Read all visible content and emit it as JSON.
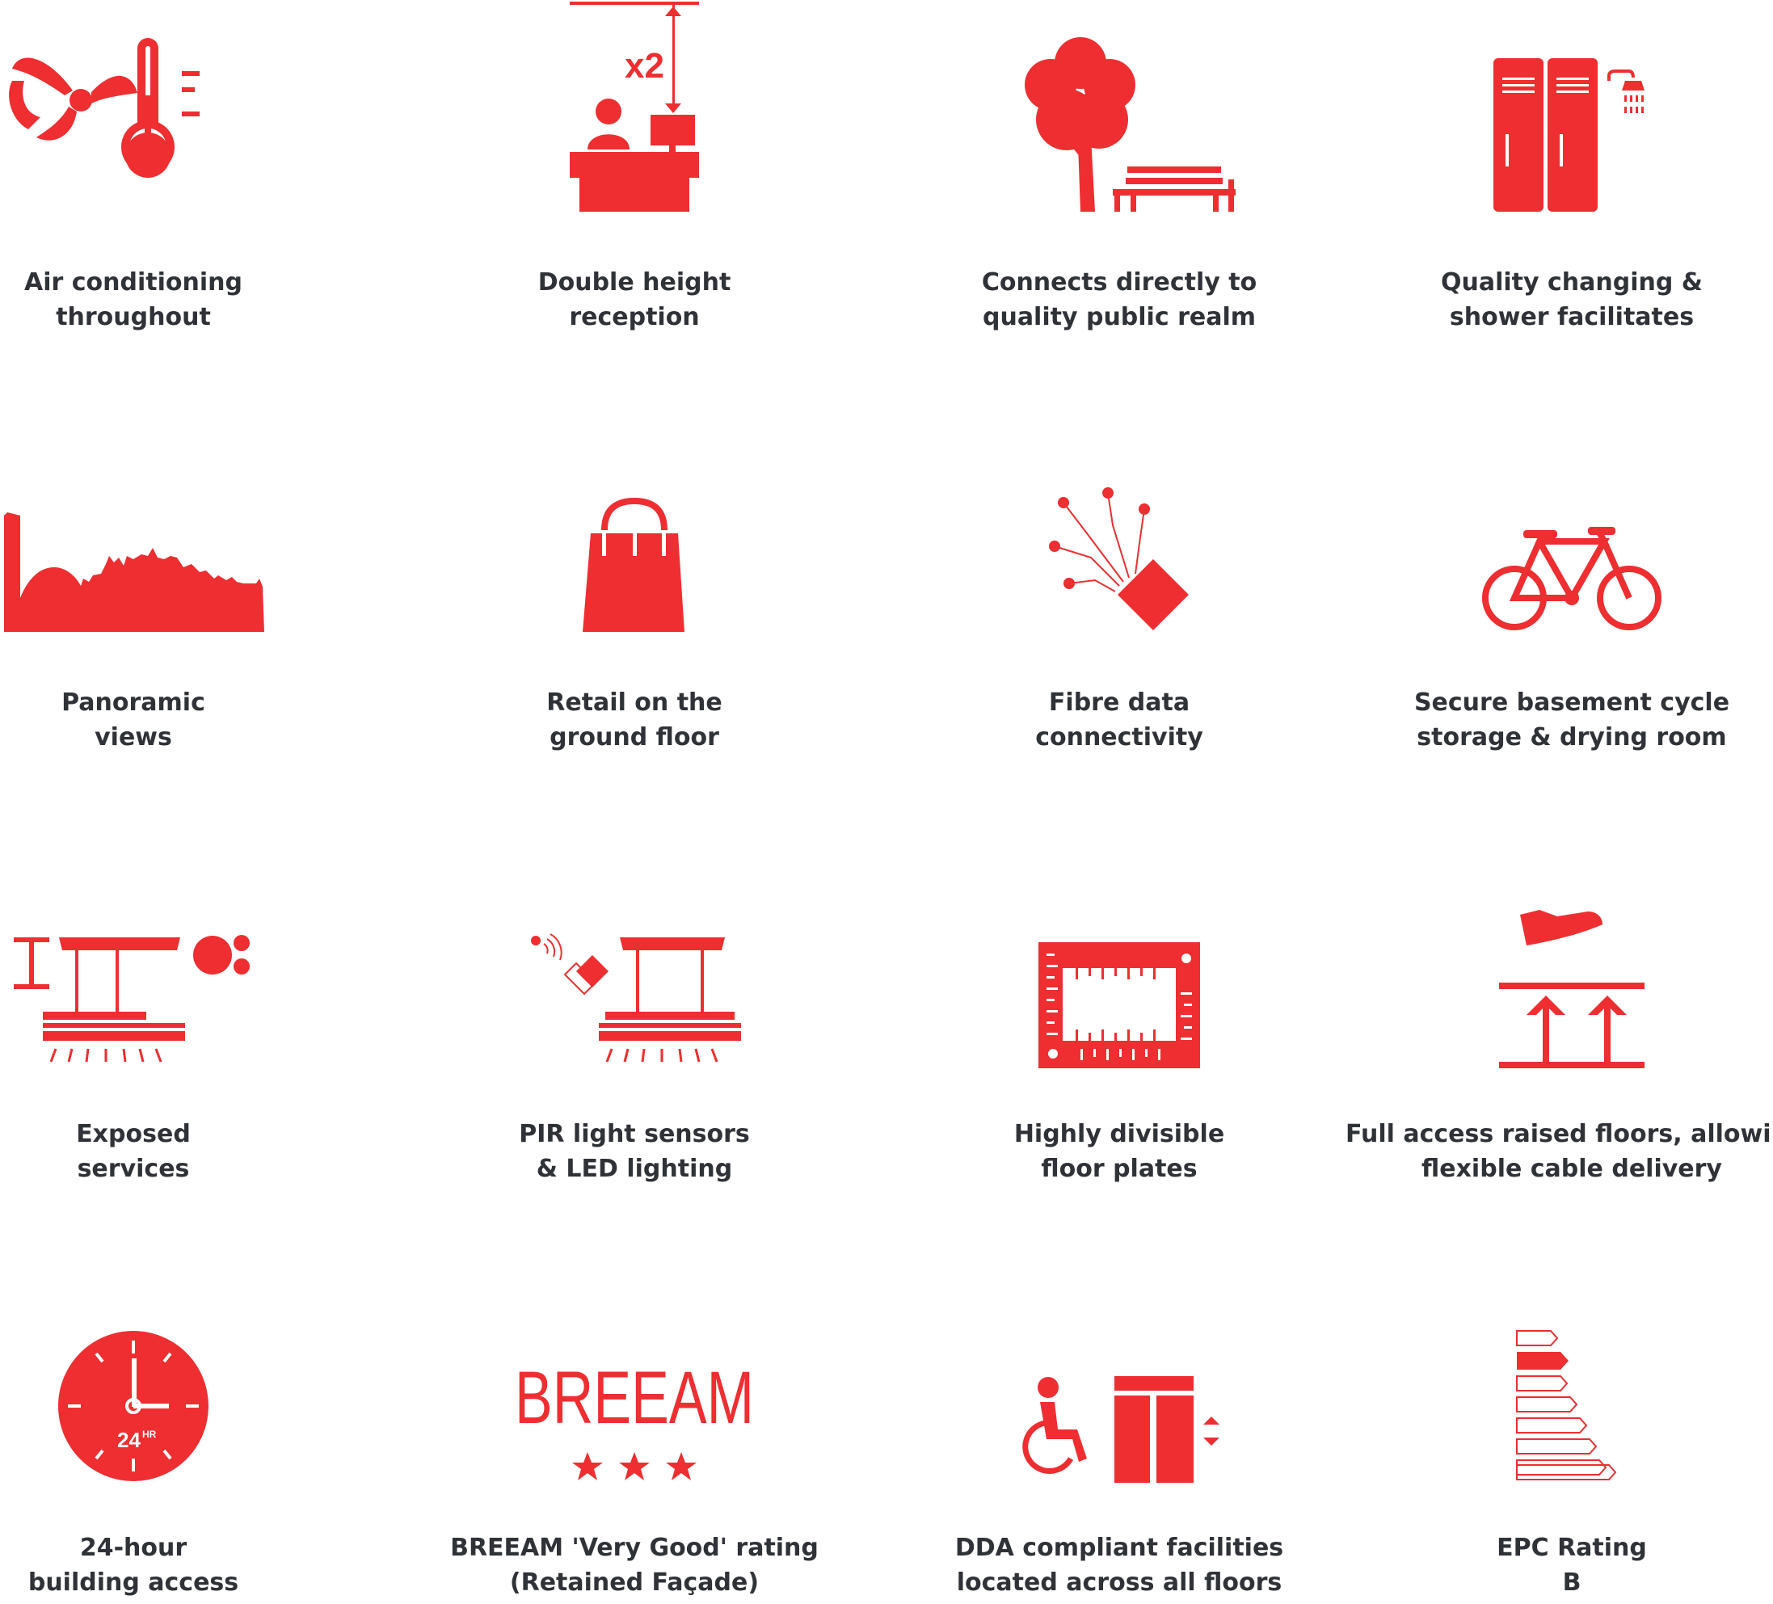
{
  "accent_color": "#ee2e31",
  "text_color": "#2f3237",
  "features": [
    {
      "id": "air-conditioning",
      "icon": "fan-thermometer-icon",
      "line1": "Air conditioning",
      "line2": "throughout"
    },
    {
      "id": "double-height-reception",
      "icon": "reception-desk-icon",
      "icon_text": "x2",
      "line1": "Double height",
      "line2": "reception"
    },
    {
      "id": "public-realm",
      "icon": "tree-bench-icon",
      "line1": "Connects directly to",
      "line2": "quality public realm"
    },
    {
      "id": "changing-shower",
      "icon": "lockers-shower-icon",
      "line1": "Quality changing &",
      "line2": "shower facilitates"
    },
    {
      "id": "panoramic-views",
      "icon": "skyline-icon",
      "line1": "Panoramic",
      "line2": "views"
    },
    {
      "id": "retail",
      "icon": "shopping-bag-icon",
      "line1": "Retail on the",
      "line2": "ground floor"
    },
    {
      "id": "fibre-data",
      "icon": "fibre-connector-icon",
      "line1": "Fibre data",
      "line2": "connectivity"
    },
    {
      "id": "cycle-storage",
      "icon": "bicycle-icon",
      "line1": "Secure basement cycle",
      "line2": "storage & drying room"
    },
    {
      "id": "exposed-services",
      "icon": "ceiling-services-icon",
      "line1": "Exposed",
      "line2": "services"
    },
    {
      "id": "pir-led",
      "icon": "sensor-light-icon",
      "line1": "PIR light sensors",
      "line2": "& LED lighting"
    },
    {
      "id": "floor-plates",
      "icon": "floor-plan-icon",
      "line1": "Highly divisible",
      "line2": "floor plates"
    },
    {
      "id": "raised-floors",
      "icon": "raised-floor-icon",
      "line1": "Full access raised floors, allowing",
      "line2": "flexible cable delivery"
    },
    {
      "id": "building-access",
      "icon": "clock-24hr-icon",
      "icon_text": "24",
      "icon_text_sup": "HR",
      "line1": "24-hour",
      "line2": "building access"
    },
    {
      "id": "breeam",
      "icon": "breeam-stars-icon",
      "icon_text": "BREEAM",
      "line1": "BREEAM 'Very Good' rating",
      "line2": "(Retained Façade)"
    },
    {
      "id": "dda",
      "icon": "wheelchair-lift-icon",
      "line1": "DDA compliant facilities",
      "line2": "located across all floors"
    },
    {
      "id": "epc",
      "icon": "epc-bars-icon",
      "line1": "EPC Rating",
      "line2": "B"
    }
  ]
}
